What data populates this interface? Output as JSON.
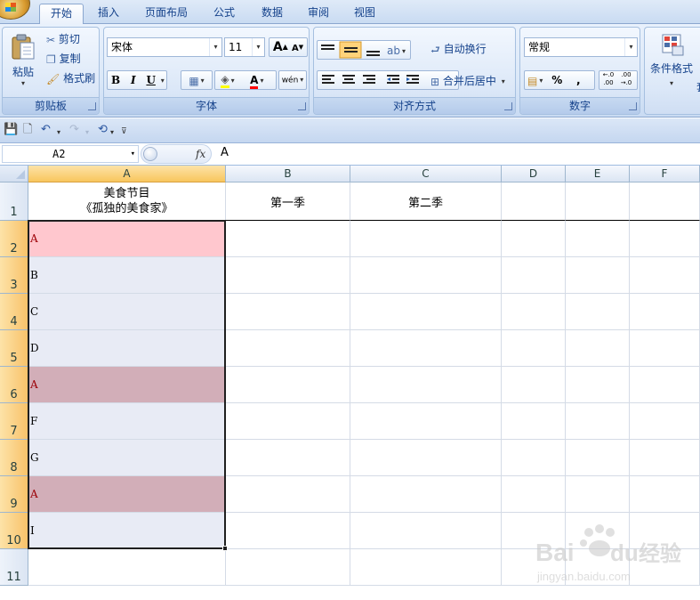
{
  "tabs": [
    "开始",
    "插入",
    "页面布局",
    "公式",
    "数据",
    "审阅",
    "视图"
  ],
  "active_tab": 0,
  "clipboard": {
    "paste": "粘贴",
    "cut": "剪切",
    "copy": "复制",
    "format_painter": "格式刷",
    "label": "剪贴板"
  },
  "font": {
    "name": "宋体",
    "size": "11",
    "grow": "A",
    "shrink": "A",
    "bold": "B",
    "italic": "I",
    "underline": "U",
    "font_color_glyph": "A",
    "phonetic": "wén",
    "label": "字体"
  },
  "alignment": {
    "wrap_text": "自动换行",
    "merge_center": "合并后居中",
    "label": "对齐方式"
  },
  "number": {
    "format": "常规",
    "percent": "%",
    "comma": ",",
    "inc_decimal": "←.0\n.00",
    "dec_decimal": ".00\n→.0",
    "label": "数字"
  },
  "styles": {
    "conditional": "条件格式",
    "cutoff": "套"
  },
  "formula_bar": {
    "name_box": "A2",
    "fx": "fx",
    "content": "A"
  },
  "columns": [
    "A",
    "B",
    "C",
    "D",
    "E",
    "F"
  ],
  "rows": [
    {
      "num": "1",
      "a_line1": "美食节目",
      "a_line2": "《孤独的美食家》",
      "b": "第一季",
      "c": "第二季"
    },
    {
      "num": "2",
      "a": "A",
      "fill": "#ffc7ce",
      "font_color": "#9c0006"
    },
    {
      "num": "3",
      "a": "B",
      "fill": "#e8ebf5",
      "font_color": "#000000"
    },
    {
      "num": "4",
      "a": "C",
      "fill": "#e8ebf5",
      "font_color": "#000000"
    },
    {
      "num": "5",
      "a": "D",
      "fill": "#e8ebf5",
      "font_color": "#000000"
    },
    {
      "num": "6",
      "a": "A",
      "fill": "#d2aeb8",
      "font_color": "#9c0006"
    },
    {
      "num": "7",
      "a": "F",
      "fill": "#e8ebf5",
      "font_color": "#000000"
    },
    {
      "num": "8",
      "a": "G",
      "fill": "#e8ebf5",
      "font_color": "#000000"
    },
    {
      "num": "9",
      "a": "A",
      "fill": "#d2aeb8",
      "font_color": "#9c0006"
    },
    {
      "num": "10",
      "a": "I",
      "fill": "#e8ebf5",
      "font_color": "#000000"
    },
    {
      "num": "11",
      "a": "",
      "fill": "#ffffff",
      "font_color": "#000000"
    }
  ],
  "watermark": {
    "brand_a": "Bai",
    "brand_b": "du",
    "brand_c": "经验",
    "url": "jingyan.baidu.com"
  }
}
